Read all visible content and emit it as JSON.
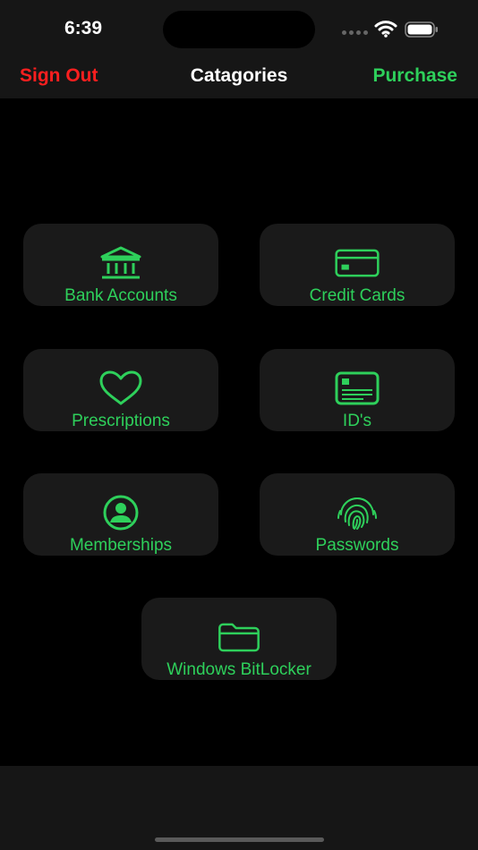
{
  "status": {
    "time": "6:39",
    "icons": [
      "signal-dots-icon",
      "wifi-icon",
      "battery-icon"
    ]
  },
  "nav": {
    "left_label": "Sign Out",
    "title": "Catagories",
    "right_label": "Purchase"
  },
  "colors": {
    "accent_green": "#2ed05b",
    "danger_red": "#ff1f1f",
    "tile_bg": "#1a1a1a",
    "bar_bg": "#161616"
  },
  "categories": [
    {
      "label": "Bank Accounts",
      "icon": "bank-icon"
    },
    {
      "label": "Credit Cards",
      "icon": "credit-card-icon"
    },
    {
      "label": "Prescriptions",
      "icon": "heart-icon"
    },
    {
      "label": "ID's",
      "icon": "id-card-icon"
    },
    {
      "label": "Memberships",
      "icon": "person-circle-icon"
    },
    {
      "label": "Passwords",
      "icon": "fingerprint-icon"
    },
    {
      "label": "Windows BitLocker",
      "icon": "folder-icon"
    }
  ]
}
